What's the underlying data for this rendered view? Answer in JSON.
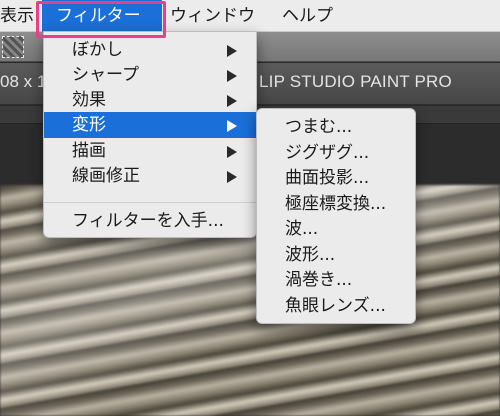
{
  "menubar": {
    "items": [
      {
        "label": "表示"
      },
      {
        "label": "フィルター"
      },
      {
        "label": "ウィンドウ"
      },
      {
        "label": "ヘルプ"
      }
    ],
    "active_index": 1,
    "highlight_color": "#e93f8a",
    "accent_color": "#1a6fd8"
  },
  "app": {
    "title_left": "08 x 1",
    "title_right": "LIP STUDIO PAINT PRO"
  },
  "filter_menu": {
    "items": [
      {
        "label": "ぼかし",
        "has_submenu": true
      },
      {
        "label": "シャープ",
        "has_submenu": true
      },
      {
        "label": "効果",
        "has_submenu": true
      },
      {
        "label": "変形",
        "has_submenu": true,
        "selected": true
      },
      {
        "label": "描画",
        "has_submenu": true
      },
      {
        "label": "線画修正",
        "has_submenu": true
      }
    ],
    "footer_item": {
      "label": "フィルターを入手..."
    }
  },
  "transform_submenu": {
    "items": [
      {
        "label": "つまむ..."
      },
      {
        "label": "ジグザグ..."
      },
      {
        "label": "曲面投影..."
      },
      {
        "label": "極座標変換..."
      },
      {
        "label": "波..."
      },
      {
        "label": "波形..."
      },
      {
        "label": "渦巻き..."
      },
      {
        "label": "魚眼レンズ..."
      }
    ]
  }
}
